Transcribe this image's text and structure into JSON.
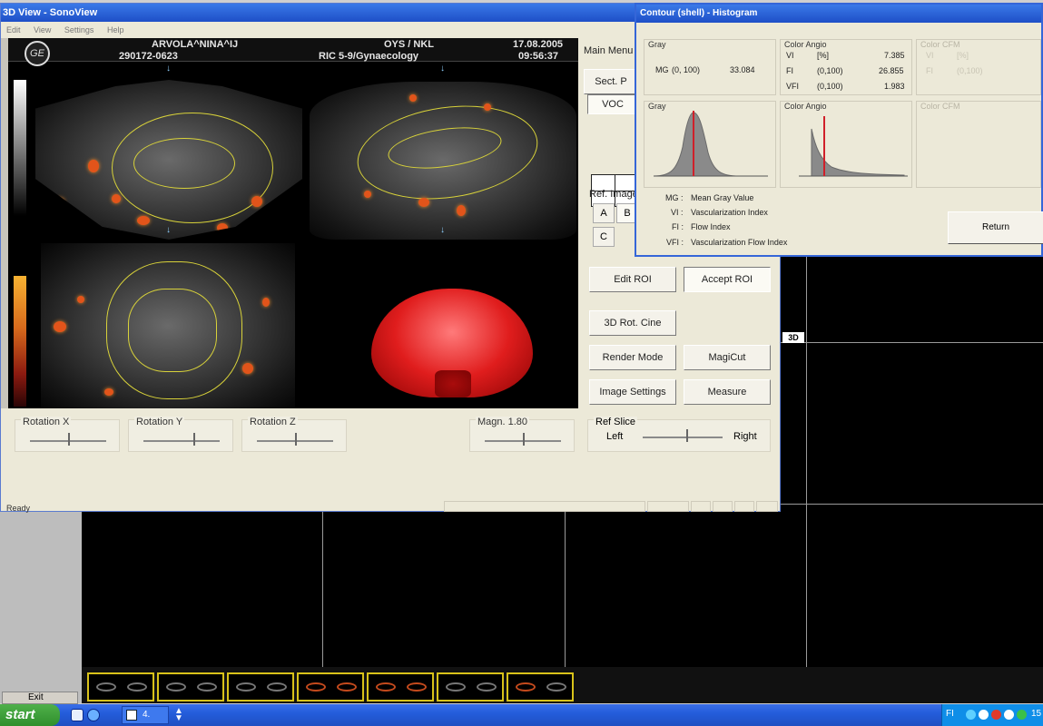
{
  "main_window": {
    "title": "3D View - SonoView",
    "menu": [
      "Edit",
      "View",
      "Settings",
      "Help"
    ],
    "status": "Ready"
  },
  "patient_header": {
    "name": "ARVOLA^NINA^IJ",
    "id": "290172-0623",
    "institution": "OYS / NKL",
    "probe": "RIC 5-9/Gynaecology",
    "date": "17.08.2005",
    "time": "09:56:37"
  },
  "workspace_tag": "3D",
  "rotation_sliders": {
    "x": {
      "label": "Rotation X",
      "value": 0.5
    },
    "y": {
      "label": "Rotation Y",
      "value": 0.65
    },
    "z": {
      "label": "Rotation Z",
      "value": 0.5
    }
  },
  "magn": {
    "label": "Magn. 1.80",
    "value": 0.5
  },
  "ref_slice": {
    "label": "Ref Slice",
    "left": "Left",
    "right": "Right",
    "value": 0.55
  },
  "side_panel": {
    "main_menu": "Main Menu",
    "sect_planes": "Sect. P",
    "voc": "VOC",
    "ref_image": "Ref. Image",
    "ref_buttons": [
      "A",
      "B",
      "C"
    ],
    "edit_roi": "Edit ROI",
    "accept_roi": "Accept ROI",
    "rot_cine": "3D Rot. Cine",
    "render_mode": "Render Mode",
    "magicut": "MagiCut",
    "image_settings": "Image Settings",
    "measure": "Measure"
  },
  "histogram_window": {
    "title": "Contour (shell) - Histogram",
    "gray_group": {
      "label": "Gray",
      "mg_label": "MG",
      "mg_range": "(0, 100)",
      "mg_value": "33.084"
    },
    "color_angio_group": {
      "label": "Color Angio",
      "rows": [
        {
          "name": "VI",
          "unit": "[%]",
          "value": "7.385"
        },
        {
          "name": "FI",
          "unit": "(0,100)",
          "value": "26.855"
        },
        {
          "name": "VFI",
          "unit": "(0,100)",
          "value": "1.983"
        }
      ]
    },
    "color_cfm_group": {
      "label": "Color CFM",
      "rows": [
        {
          "name": "VI",
          "unit": "[%]"
        },
        {
          "name": "FI",
          "unit": "(0,100)"
        }
      ]
    },
    "plot_labels": {
      "gray": "Gray",
      "color_angio": "Color Angio",
      "color_cfm": "Color CFM"
    },
    "legend": [
      {
        "abbr": "MG :",
        "text": "Mean Gray Value"
      },
      {
        "abbr": "VI :",
        "text": "Vascularization Index"
      },
      {
        "abbr": "FI :",
        "text": "Flow Index"
      },
      {
        "abbr": "VFI :",
        "text": "Vascularization Flow Index"
      }
    ],
    "return_label": "Return"
  },
  "desktop": {
    "exit_label": "Exit",
    "start_label": "start",
    "task_label": "4.",
    "tray_lang": "FI",
    "tray_clock": "15"
  },
  "colors": {
    "title_blue": "#1e4fc7",
    "contour_yellow": "#d8d23a",
    "flow_orange": "#e2541a",
    "render_red": "#e01d1d",
    "histogram_marker": "#d0202a",
    "thumb_border": "#d8c21a"
  }
}
